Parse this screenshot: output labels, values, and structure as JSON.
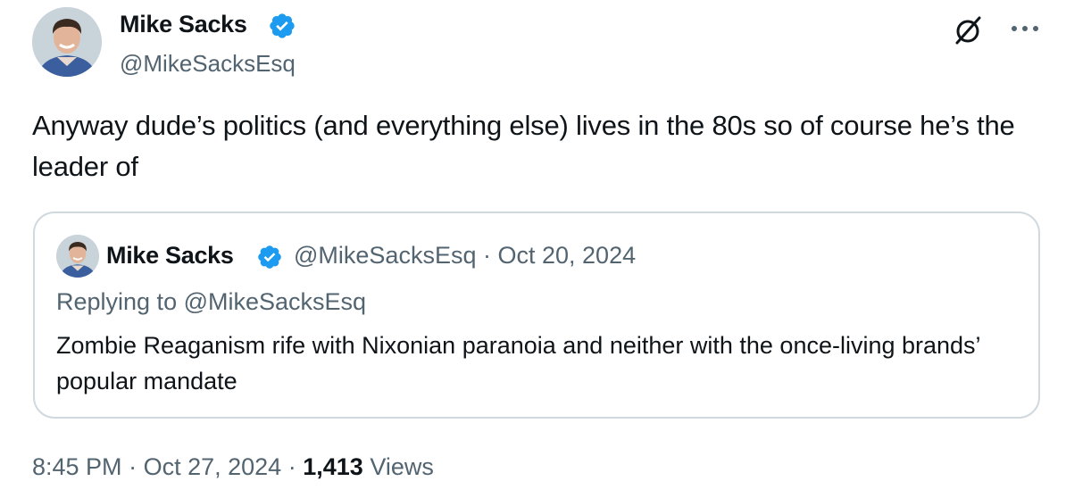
{
  "author": {
    "name": "Mike Sacks",
    "handle": "@MikeSacksEsq",
    "verified_color": "#1d9bf0"
  },
  "tweet": {
    "text": "Anyway dude’s politics (and everything else) lives in the 80s so of course he’s the leader of"
  },
  "quoted_tweet": {
    "name": "Mike Sacks",
    "handle": "@MikeSacksEsq",
    "separator": "·",
    "date": "Oct 20, 2024",
    "replying_to": "Replying to @MikeSacksEsq",
    "text": "Zombie Reaganism rife with Nixonian paranoia and neither with the once-living brands’ popular mandate"
  },
  "footer": {
    "time": "8:45 PM",
    "separator": "·",
    "date": "Oct 27, 2024",
    "views_count": "1,413",
    "views_label": "Views"
  },
  "icons": {
    "grok": "grok-icon",
    "more": "more-icon",
    "verified": "verified-badge-icon"
  },
  "colors": {
    "text_primary": "#0f1419",
    "text_secondary": "#536471",
    "border": "#cfd9de",
    "accent": "#1d9bf0"
  }
}
